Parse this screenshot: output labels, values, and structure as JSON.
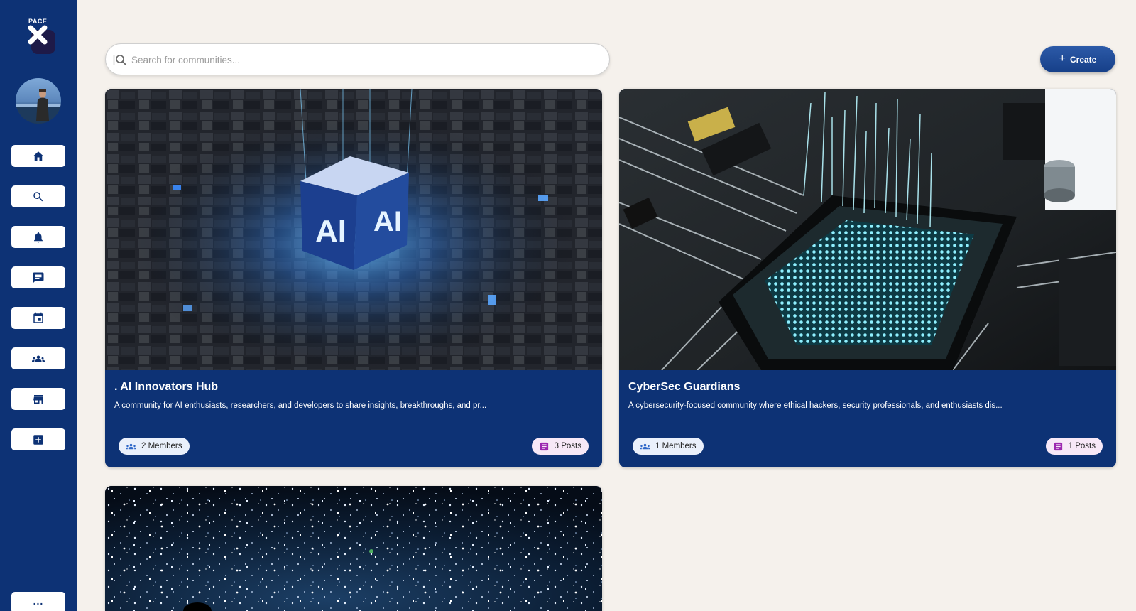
{
  "sidebar": {
    "logo_text": "PACE",
    "nav_items": [
      {
        "name": "home",
        "icon": "home-icon"
      },
      {
        "name": "search",
        "icon": "search-icon"
      },
      {
        "name": "notifications",
        "icon": "bell-icon"
      },
      {
        "name": "messages",
        "icon": "chat-icon"
      },
      {
        "name": "events",
        "icon": "calendar-icon"
      },
      {
        "name": "communities",
        "icon": "groups-icon"
      },
      {
        "name": "marketplace",
        "icon": "store-icon"
      },
      {
        "name": "create",
        "icon": "add-box-icon"
      }
    ],
    "more_label": "..."
  },
  "search": {
    "placeholder": "Search for communities...",
    "value": ""
  },
  "toolbar": {
    "create_label": "Create"
  },
  "communities": [
    {
      "title": ". AI Innovators Hub",
      "description": "A community for AI enthusiasts, researchers, and developers to share insights, breakthroughs, and pr...",
      "members": "2 Members",
      "posts": "3 Posts"
    },
    {
      "title": "CyberSec Guardians",
      "description": "A cybersecurity-focused community where ethical hackers, security professionals, and enthusiasts dis...",
      "members": "1 Members",
      "posts": "1 Posts"
    }
  ],
  "colors": {
    "sidebar": "#0d3275",
    "background": "#f5f1ec",
    "card": "#0d3275",
    "create_button": "#1f4b97",
    "members_badge": "#eaf0fb",
    "posts_badge": "#f7e8f7",
    "members_icon": "#2e67c8",
    "posts_icon": "#9c27b0"
  }
}
